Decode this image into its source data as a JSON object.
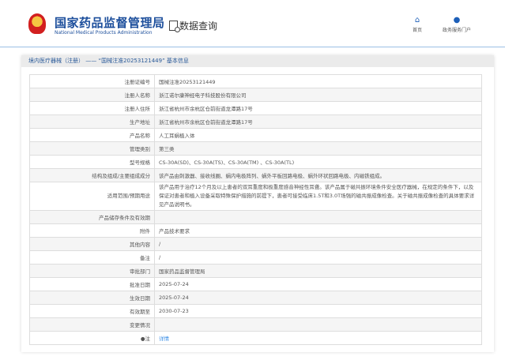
{
  "header": {
    "brand_cn": "国家药品监督管理局",
    "brand_en": "National Medical Products Administration",
    "section": "数据查询",
    "nav": [
      {
        "label": "首页",
        "icon": "home-icon"
      },
      {
        "label": "政务服务门户",
        "icon": "user-icon"
      }
    ]
  },
  "card_title": "境内医疗器械（注册） —— “国械注准20253121449” 基本信息",
  "rows": [
    {
      "label": "注册证编号",
      "value": "国械注准20253121449"
    },
    {
      "label": "注册人名称",
      "value": "浙江诺尔康神经电子科技股份有限公司"
    },
    {
      "label": "注册人住所",
      "value": "浙江省杭州市余杭区仓前街道龙潭路17号"
    },
    {
      "label": "生产地址",
      "value": "浙江省杭州市余杭区仓前街道龙潭路17号"
    },
    {
      "label": "产品名称",
      "value": "人工耳蜗植入体"
    },
    {
      "label": "管理类别",
      "value": "第三类"
    },
    {
      "label": "型号规格",
      "value": "CS-30A(SD)、CS-30A(TS)、CS-30A(TM) 、CS-30A(TL)"
    },
    {
      "label": "结构及组成/主要组成成分",
      "value": "该产品由刺激器、接收线圈、蜗内电极阵列、蜗外平板回路电极、蜗外环状回路电极、内磁铁组成。"
    },
    {
      "label": "适用范围/预期用途",
      "value": "该产品用于治疗12个月及以上患者的双耳重度和极重度感音神经性耳聋。该产品属于磁共振环境条件安全医疗器械，在规定的条件下，以及保证对患者和植入设备采取特殊保护措施的前提下，患者可接受临床1.5T和3.0T场强的磁共振成像检查。关于磁共振成像检查的具体要求详见产品说明书。"
    },
    {
      "label": "产品储存条件及有效期",
      "value": ""
    },
    {
      "label": "附件",
      "value": "产品技术要求"
    },
    {
      "label": "其他内容",
      "value": "/"
    },
    {
      "label": "备注",
      "value": "/"
    },
    {
      "label": "审批部门",
      "value": "国家药品监督管理局"
    },
    {
      "label": "批准日期",
      "value": "2025-07-24"
    },
    {
      "label": "生效日期",
      "value": "2025-07-24"
    },
    {
      "label": "有效期至",
      "value": "2030-07-23"
    },
    {
      "label": "变更情况",
      "value": ""
    },
    {
      "label": "注",
      "value": "详情"
    }
  ]
}
